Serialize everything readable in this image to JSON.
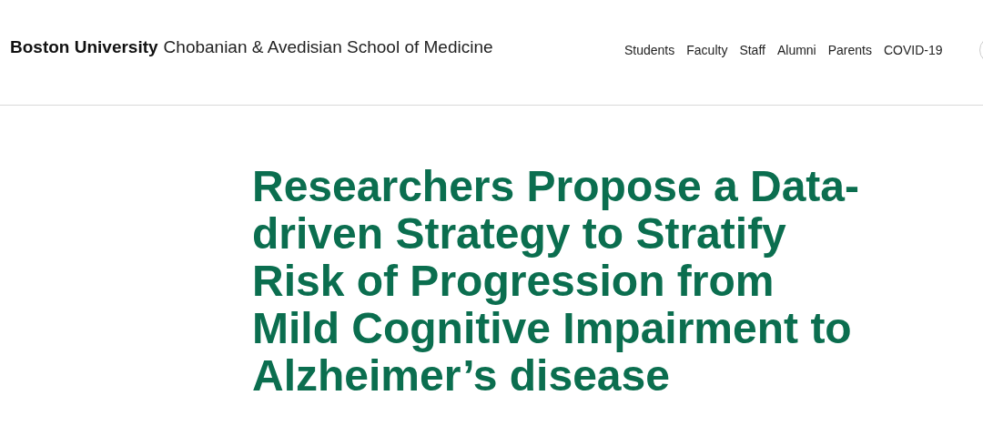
{
  "header": {
    "brand": "Boston University",
    "school": "Chobanian & Avedisian School of Medicine",
    "nav": [
      "Students",
      "Faculty",
      "Staff",
      "Alumni",
      "Parents",
      "COVID-19"
    ]
  },
  "article": {
    "title_lines": [
      "Researchers Propose a Data-",
      "driven Strategy to Stratify",
      "Risk of Progression from",
      "Mild Cognitive Impairment to",
      "Alzheimer’s disease"
    ]
  }
}
